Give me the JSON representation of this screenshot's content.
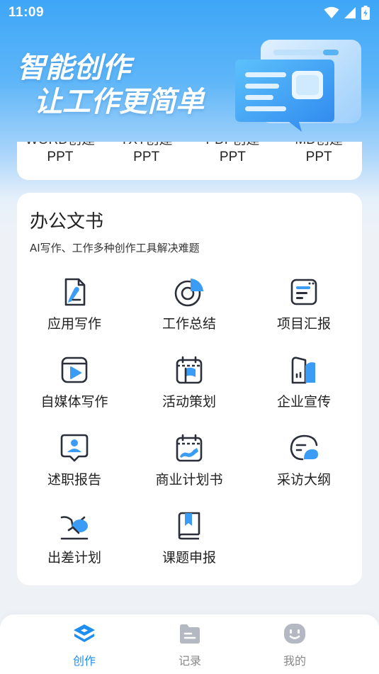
{
  "status_bar": {
    "time": "11:09"
  },
  "hero": {
    "title_line1": "智能创作",
    "title_line2": "让工作更简单"
  },
  "top_card": {
    "items": [
      {
        "partial": "WORD创建",
        "label": "PPT"
      },
      {
        "partial": "TXT创建",
        "label": "PPT"
      },
      {
        "partial": "PDF创建",
        "label": "PPT"
      },
      {
        "partial": "MD创建",
        "label": "PPT"
      }
    ]
  },
  "office": {
    "title": "办公文书",
    "subtitle": "AI写作、工作多种创作工具解决难题",
    "tools": [
      {
        "label": "应用写作",
        "icon": "pen-document-icon"
      },
      {
        "label": "工作总结",
        "icon": "pie-chart-icon"
      },
      {
        "label": "项目汇报",
        "icon": "report-card-icon"
      },
      {
        "label": "自媒体写作",
        "icon": "video-play-icon"
      },
      {
        "label": "活动策划",
        "icon": "calendar-flag-icon"
      },
      {
        "label": "企业宣传",
        "icon": "building-icon"
      },
      {
        "label": "述职报告",
        "icon": "person-badge-icon"
      },
      {
        "label": "商业计划书",
        "icon": "calendar-trend-icon"
      },
      {
        "label": "采访大纲",
        "icon": "chat-bubbles-icon"
      },
      {
        "label": "出差计划",
        "icon": "airplane-icon"
      },
      {
        "label": "课题申报",
        "icon": "bookmark-book-icon"
      }
    ]
  },
  "bottom_nav": {
    "items": [
      {
        "label": "创作",
        "icon": "layers-icon",
        "active": true
      },
      {
        "label": "记录",
        "icon": "folder-icon",
        "active": false
      },
      {
        "label": "我的",
        "icon": "smiley-icon",
        "active": false
      }
    ]
  },
  "colors": {
    "accent": "#1f8ef1",
    "icon_blue": "#3b9cf5",
    "icon_stroke": "#2b2f3a"
  }
}
